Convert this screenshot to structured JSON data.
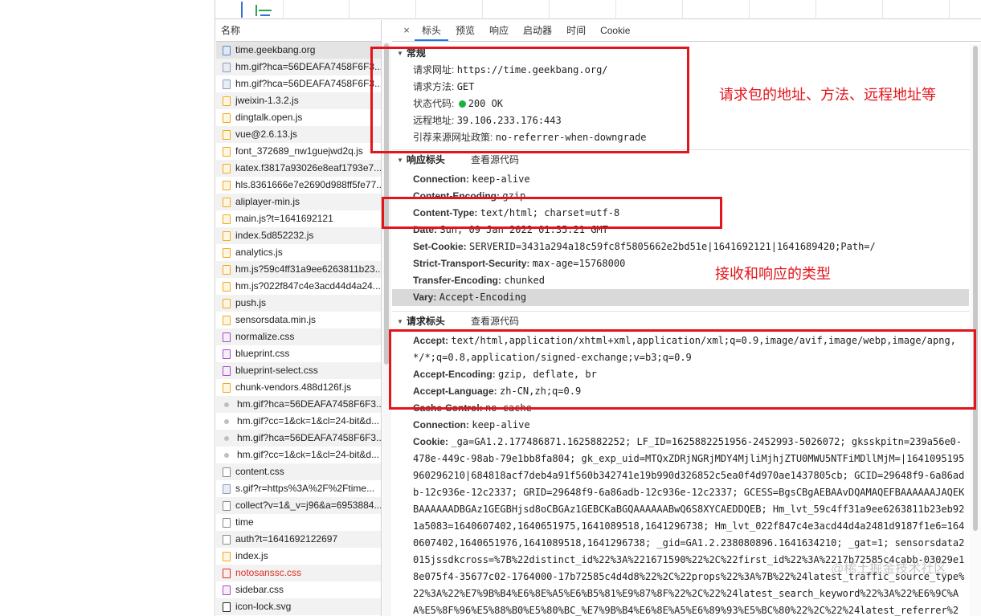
{
  "name_panel": {
    "header": "名称",
    "rows": [
      {
        "name": "time.geekbang.org",
        "type": "doc",
        "selected": true
      },
      {
        "name": "hm.gif?hca=56DEAFA7458F6F3...",
        "type": "img"
      },
      {
        "name": "hm.gif?hca=56DEAFA7458F6F3...",
        "type": "img"
      },
      {
        "name": "jweixin-1.3.2.js",
        "type": "js"
      },
      {
        "name": "dingtalk.open.js",
        "type": "js"
      },
      {
        "name": "vue@2.6.13.js",
        "type": "js"
      },
      {
        "name": "font_372689_nw1guejwd2q.js",
        "type": "js"
      },
      {
        "name": "katex.f3817a93026e8eaf1793e7...",
        "type": "js"
      },
      {
        "name": "hls.8361666e7e2690d988ff5fe77...",
        "type": "js"
      },
      {
        "name": "aliplayer-min.js",
        "type": "js"
      },
      {
        "name": "main.js?t=1641692121",
        "type": "js"
      },
      {
        "name": "index.5d852232.js",
        "type": "js"
      },
      {
        "name": "analytics.js",
        "type": "js"
      },
      {
        "name": "hm.js?59c4ff31a9ee6263811b23...",
        "type": "js"
      },
      {
        "name": "hm.js?022f847c4e3acd44d4a24...",
        "type": "js"
      },
      {
        "name": "push.js",
        "type": "js"
      },
      {
        "name": "sensorsdata.min.js",
        "type": "js"
      },
      {
        "name": "normalize.css",
        "type": "css"
      },
      {
        "name": "blueprint.css",
        "type": "css"
      },
      {
        "name": "blueprint-select.css",
        "type": "css"
      },
      {
        "name": "chunk-vendors.488d126f.js",
        "type": "js"
      },
      {
        "name": "hm.gif?hca=56DEAFA7458F6F3...",
        "type": "dot"
      },
      {
        "name": "hm.gif?cc=1&ck=1&cl=24-bit&d...",
        "type": "dot"
      },
      {
        "name": "hm.gif?hca=56DEAFA7458F6F3...",
        "type": "dot"
      },
      {
        "name": "hm.gif?cc=1&ck=1&cl=24-bit&d...",
        "type": "dot"
      },
      {
        "name": "content.css",
        "type": "plain"
      },
      {
        "name": "s.gif?r=https%3A%2F%2Ftime...",
        "type": "img"
      },
      {
        "name": "collect?v=1&_v=j96&a=6953884...",
        "type": "plain"
      },
      {
        "name": "time",
        "type": "plain"
      },
      {
        "name": "auth?t=1641692122697",
        "type": "plain"
      },
      {
        "name": "index.js",
        "type": "js"
      },
      {
        "name": "notosanssc.css",
        "type": "err"
      },
      {
        "name": "sidebar.css",
        "type": "css"
      },
      {
        "name": "icon-lock.svg",
        "type": "svg"
      }
    ]
  },
  "tabs": {
    "close": "×",
    "items": [
      "标头",
      "预览",
      "响应",
      "启动器",
      "时间",
      "Cookie"
    ]
  },
  "general": {
    "title": "常规",
    "rows": [
      {
        "k": "请求网址:",
        "v": "https://time.geekbang.org/"
      },
      {
        "k": "请求方法:",
        "v": "GET"
      },
      {
        "k": "状态代码:",
        "v": "200 OK"
      },
      {
        "k": "远程地址:",
        "v": "39.106.233.176:443"
      },
      {
        "k": "引荐来源网址政策:",
        "v": "no-referrer-when-downgrade"
      }
    ]
  },
  "response_headers": {
    "title": "响应标头",
    "view_source": "查看源代码",
    "rows": [
      {
        "k": "Connection:",
        "v": "keep-alive"
      },
      {
        "k": "Content-Encoding:",
        "v": "gzip"
      },
      {
        "k": "Content-Type:",
        "v": "text/html; charset=utf-8"
      },
      {
        "k": "Date:",
        "v": "Sun, 09 Jan 2022 01:35:21 GMT"
      },
      {
        "k": "Set-Cookie:",
        "v": "SERVERID=3431a294a18c59fc8f5805662e2bd51e|1641692121|1641689420;Path=/"
      },
      {
        "k": "Strict-Transport-Security:",
        "v": "max-age=15768000"
      },
      {
        "k": "Transfer-Encoding:",
        "v": "chunked"
      },
      {
        "k": "Vary:",
        "v": "Accept-Encoding"
      }
    ]
  },
  "request_headers": {
    "title": "请求标头",
    "view_source": "查看源代码",
    "rows": [
      {
        "k": "Accept:",
        "v": "text/html,application/xhtml+xml,application/xml;q=0.9,image/avif,image/webp,image/apng,*/*;q=0.8,application/signed-exchange;v=b3;q=0.9"
      },
      {
        "k": "Accept-Encoding:",
        "v": "gzip, deflate, br"
      },
      {
        "k": "Accept-Language:",
        "v": "zh-CN,zh;q=0.9"
      },
      {
        "k": "Cache-Control:",
        "v": "no-cache"
      },
      {
        "k": "Connection:",
        "v": "keep-alive"
      },
      {
        "k": "Cookie:",
        "v": "_ga=GA1.2.177486871.1625882252; LF_ID=1625882251956-2452993-5026072; gksskpitn=239a56e0-478e-449c-98ab-79e1bb8fa804; gk_exp_uid=MTQxZDRjNGRjMDY4MjliMjhjZTU0MWU5NTFiMDllMjM=|1641095195960296210|684818acf7deb4a91f560b342741e19b990d326852c5ea0f4d970ae1437805cb; GCID=29648f9-6a86adb-12c936e-12c2337; GRID=29648f9-6a86adb-12c936e-12c2337; GCESS=BgsCBgAEBAAvDQAMAQEFBAAAAAAJAQEKBAAAAAADBGAz1GEGBHjsd8oCBGAz1GEBCKaBGQAAAAAABwQ6S8XYCAEDDQEB; Hm_lvt_59c4ff31a9ee6263811b23eb921a5083=1640607402,1640651975,1641089518,1641296738; Hm_lvt_022f847c4e3acd44d4a2481d9187f1e6=1640607402,1640651976,1641089518,1641296738; _gid=GA1.2.238080896.1641634210; _gat=1; sensorsdata2015jssdkcross=%7B%22distinct_id%22%3A%221671590%22%2C%22first_id%22%3A%2217b72585c4cabb-03029e18e075f4-35677c02-1764000-17b72585c4d4d8%22%2C%22props%22%3A%7B%22%24latest_traffic_source_type%22%3A%22%E7%9B%B4%E6%8E%A5%E6%B5%81%E9%87%8F%22%2C%22%24latest_search_keyword%22%3A%22%E6%9C%AA%E5%8F%96%E5%88%B0%E5%80%BC_%E7%9B%B4%E6%8E%A5%E6%89%93%E5%BC%80%22%2C%22%24latest_referrer%2"
      }
    ]
  },
  "annotations": {
    "a1": "请求包的地址、方法、远程地址等",
    "a2": "接收和响应的类型"
  },
  "watermark": "@稀土掘金技术社区",
  "colors": {
    "accent": "#1a73e8",
    "annotation": "#e3141b",
    "status_ok": "#1bb33b"
  }
}
